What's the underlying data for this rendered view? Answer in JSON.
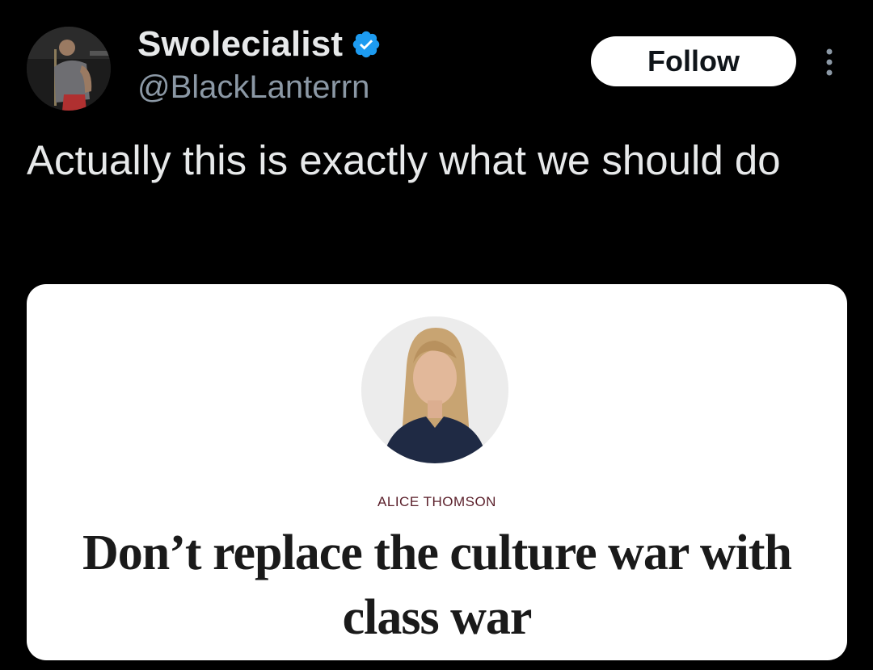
{
  "author": {
    "display_name": "Swolecialist",
    "handle": "@BlackLanterrn",
    "verified": true,
    "avatar_icon": "profile-photo"
  },
  "actions": {
    "follow_label": "Follow",
    "more_icon": "vertical-ellipsis-icon"
  },
  "tweet": {
    "text": "Actually this is exactly what we should do"
  },
  "card": {
    "byline": "ALICE THOMSON",
    "headline": "Don’t replace the culture war with class war",
    "photo_icon": "author-portrait"
  },
  "colors": {
    "background": "#000000",
    "text_primary": "#e7e9ea",
    "text_secondary": "#8b98a5",
    "verified_badge": "#1d9bf0",
    "card_background": "#ffffff",
    "byline": "#5a1f2a"
  }
}
